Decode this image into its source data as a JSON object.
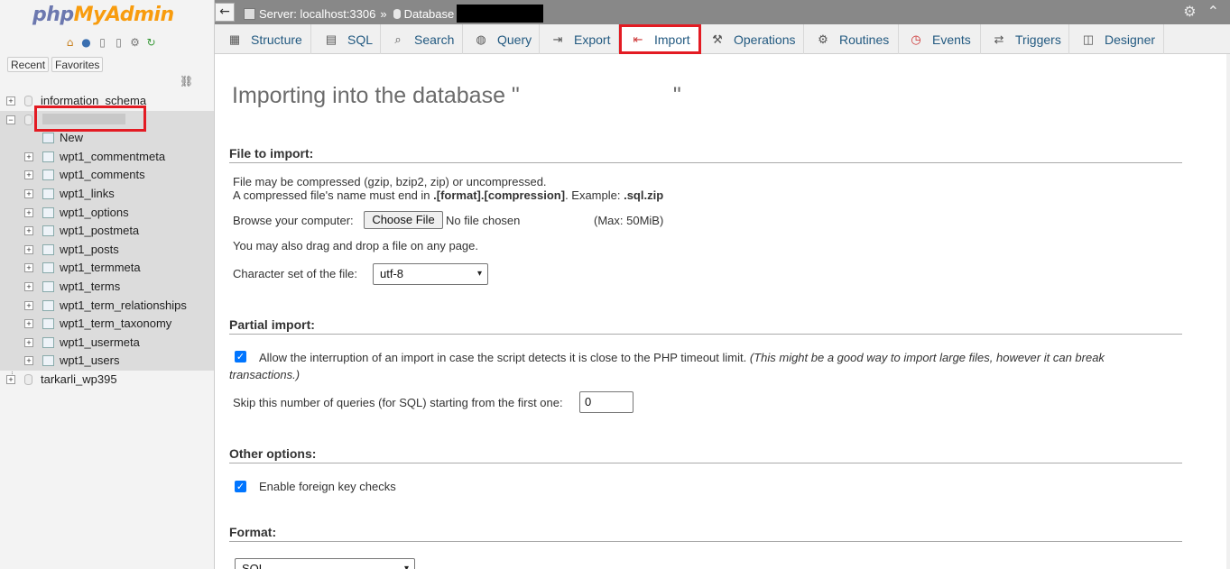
{
  "nav": {
    "logo_php": "php",
    "logo_myadmin": "MyAdmin",
    "icons": [
      "home-icon",
      "help-icon",
      "docs-icon",
      "copy-icon",
      "settings-icon",
      "reload-icon"
    ],
    "recent": "Recent",
    "favorites": "Favorites",
    "databases": [
      {
        "name": "information_schema",
        "expander": "+"
      },
      {
        "name": "",
        "expander": "−",
        "selected": true
      },
      {
        "name": "tarkarli_wp395",
        "expander": "+"
      }
    ],
    "new_label": "New",
    "tables": [
      "wpt1_commentmeta",
      "wpt1_comments",
      "wpt1_links",
      "wpt1_options",
      "wpt1_postmeta",
      "wpt1_posts",
      "wpt1_termmeta",
      "wpt1_terms",
      "wpt1_term_relationships",
      "wpt1_term_taxonomy",
      "wpt1_usermeta",
      "wpt1_users"
    ]
  },
  "topbar": {
    "back": "←",
    "server": "Server: localhost:3306",
    "sep": "»",
    "database": "Database",
    "settings_icon": "⚙",
    "collapse_icon": "⌃"
  },
  "menu": [
    {
      "label": "Structure",
      "icon": "structure-icon"
    },
    {
      "label": "SQL",
      "icon": "sql-icon"
    },
    {
      "label": "Search",
      "icon": "search-icon"
    },
    {
      "label": "Query",
      "icon": "query-icon"
    },
    {
      "label": "Export",
      "icon": "export-icon"
    },
    {
      "label": "Import",
      "icon": "import-icon",
      "active": true
    },
    {
      "label": "Operations",
      "icon": "wrench-icon"
    },
    {
      "label": "Routines",
      "icon": "routines-icon"
    },
    {
      "label": "Events",
      "icon": "clock-icon"
    },
    {
      "label": "Triggers",
      "icon": "triggers-icon"
    },
    {
      "label": "Designer",
      "icon": "designer-icon"
    }
  ],
  "main": {
    "title_open": "Importing into the database \"",
    "title_close": "\"",
    "file_section": "File to import:",
    "compress_note": "File may be compressed (gzip, bzip2, zip) or uncompressed.",
    "compress_name_pre": "A compressed file's name must end in ",
    "compress_name_fmt": ".[format].[compression]",
    "compress_name_mid": ". Example: ",
    "compress_name_ex": ".sql.zip",
    "browse_label": "Browse your computer:",
    "choose_file": "Choose File",
    "no_file": "No file chosen",
    "max_size": "(Max: 50MiB)",
    "drag_drop": "You may also drag and drop a file on any page.",
    "charset_label": "Character set of the file:",
    "charset_value": "utf-8",
    "partial_section": "Partial import:",
    "allow_interrupt": "Allow the interruption of an import in case the script detects it is close to the PHP timeout limit.",
    "allow_interrupt_note": "(This might be a good way to import large files, however it can break",
    "allow_interrupt_note2": "transactions.)",
    "skip_label": "Skip this number of queries (for SQL) starting from the first one:",
    "skip_value": "0",
    "other_section": "Other options:",
    "foreign_keys": "Enable foreign key checks",
    "format_section": "Format:",
    "format_value": "SQL"
  },
  "colors": {
    "accent_red": "#e31b23",
    "link_blue": "#235a81",
    "topbar_gray": "#888888",
    "checkbox_blue": "#0075ff"
  }
}
